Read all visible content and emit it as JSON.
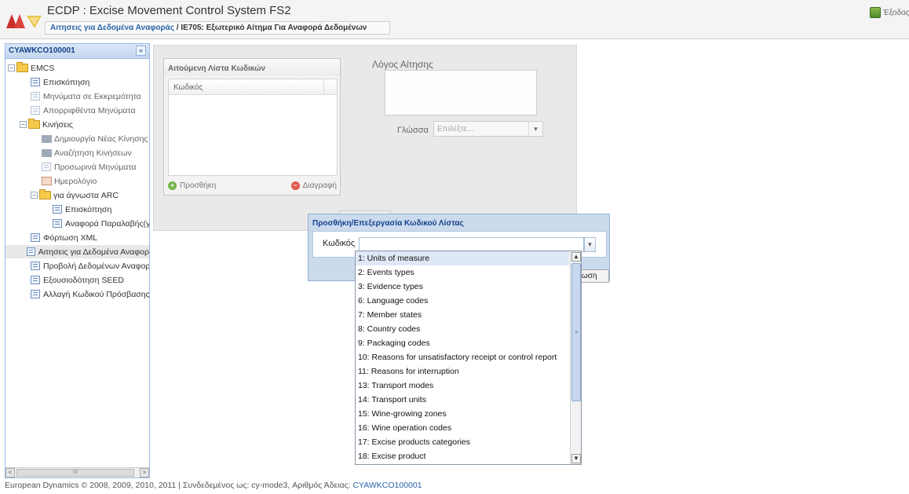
{
  "header": {
    "title": "ECDP : Excise Movement Control System FS2",
    "breadcrumb_link": "Αιτησεις για Δεδομένα Αναφοράς",
    "breadcrumb_sep": " / ",
    "breadcrumb_current": "IE705: Εξωτερικό Αίτημα Για Αναφορά Δεδομένων",
    "exit_label": "Έξοδος"
  },
  "sidebar": {
    "title": "CYAWKCO100001",
    "collapse_icon": "«",
    "tree": [
      {
        "label": "EMCS"
      },
      {
        "label": "Επισκόπηση"
      },
      {
        "label": "Μηνύματα σε Εκκρεμότητα"
      },
      {
        "label": "Απορριφθέντα Μηνύματα"
      },
      {
        "label": "Κινήσεις"
      },
      {
        "label": "Δημιουργία Νέας Κίνησης"
      },
      {
        "label": "Αναζήτηση Κινήσεων"
      },
      {
        "label": "Προσωρινά Μηνύματα"
      },
      {
        "label": "Ημερολόγιο"
      },
      {
        "label": "για άγνωστα ARC"
      },
      {
        "label": "Επισκόπηση"
      },
      {
        "label": "Αναφορά Παραλαβής(για"
      },
      {
        "label": "Φόρτωση XML"
      },
      {
        "label": "Αιτησεις για Δεδομένα Αναφορ"
      },
      {
        "label": "Προβολή Δεδομένων Αναφορά"
      },
      {
        "label": "Εξουσιοδότηση SEED"
      },
      {
        "label": "Αλλαγή Κωδικού Πρόσβασης"
      }
    ],
    "scroll_mark": "III"
  },
  "list_panel": {
    "title": "Αιτούμενη Λίστα Κωδικών",
    "column": "Κωδικός",
    "add_label": "Προσθήκη",
    "delete_label": "Διαγραφή"
  },
  "form": {
    "reason_label": "Λόγος Αίτησης",
    "language_label": "Γλώσσα",
    "language_placeholder": "Επιλέξτε..."
  },
  "dialog": {
    "title": "Προσθήκη/Επεξεργασία Κωδικού Λίστας",
    "code_label": "Κωδικός",
    "code_value": "",
    "button_fragment": "ωση"
  },
  "dropdown": {
    "options": [
      "1: Units of measure",
      "2: Events types",
      "3: Evidence types",
      "6: Language codes",
      "7: Member states",
      "8: Country codes",
      "9: Packaging codes",
      "10: Reasons for unsatisfactory receipt or control report",
      "11: Reasons for interruption",
      "13: Transport modes",
      "14: Transport units",
      "15: Wine-growing zones",
      "16: Wine operation codes",
      "17: Excise products categories",
      "18: Excise product"
    ],
    "highlighted_index": 0
  },
  "footer": {
    "text": "European Dynamics © 2008, 2009, 2010, 2011 | Συνδεδεμένος ως: cy-mode3, Αριθμός Άδειας: ",
    "license": "CYAWKCO100001"
  }
}
